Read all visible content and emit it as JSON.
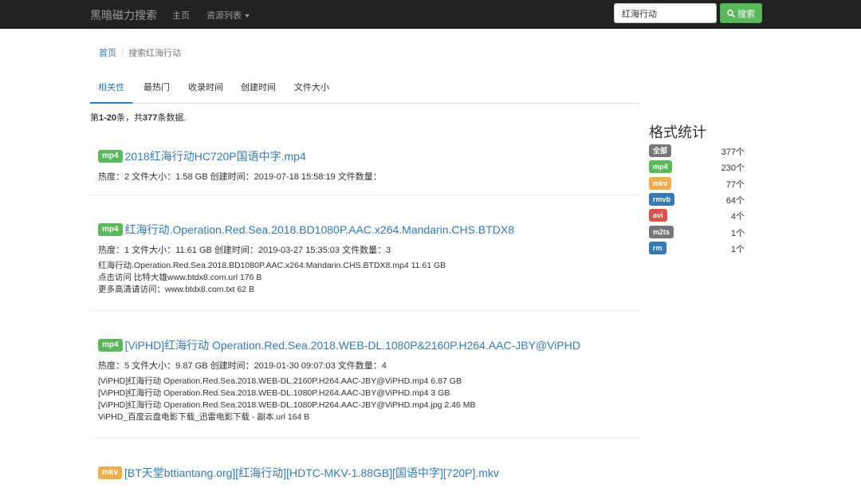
{
  "navbar": {
    "brand": "黑暗磁力搜索",
    "home": "主页",
    "resources": "资源列表",
    "search_value": "红海行动",
    "search_button": "搜索"
  },
  "breadcrumb": {
    "home": "首页",
    "separator": "/",
    "current": "搜索红海行动"
  },
  "tabs": [
    "相关性",
    "最热门",
    "收录时间",
    "创建时间",
    "文件大小"
  ],
  "summary": {
    "prefix": "第",
    "range": "1-20",
    "middle": "条，共",
    "total": "377",
    "suffix": "条数据."
  },
  "results": [
    {
      "format": "mp4",
      "title": "2018红海行动HC720P国语中字.mp4",
      "meta": "热度：2  文件大小：1.58 GB  创建时间：2019-07-18 15:58:19  文件数量：",
      "files": []
    },
    {
      "format": "mp4",
      "title": "红海行动.Operation.Red.Sea.2018.BD1080P.AAC.x264.Mandarin.CHS.BTDX8",
      "meta": "热度：1  文件大小：11.61 GB  创建时间：2019-03-27 15:35:03  文件数量：3",
      "files": [
        "红海行动.Operation.Red.Sea.2018.BD1080P.AAC.x264.Mandarin.CHS.BTDX8.mp4  11.61 GB",
        "点击访问 比特大雄www.btdx8.com.url  176 B",
        "更多高清请访问：www.btdx8.com.txt  62 B"
      ]
    },
    {
      "format": "mp4",
      "title": "[ViPHD]红海行动 Operation.Red.Sea.2018.WEB-DL.1080P&2160P.H264.AAC-JBY@ViPHD",
      "meta": "热度：5  文件大小：9.87 GB  创建时间：2019-01-30 09:07:03  文件数量：4",
      "files": [
        "[ViPHD]红海行动 Operation.Red.Sea.2018.WEB-DL.2160P.H264.AAC-JBY@ViPHD.mp4  6.87 GB",
        "[ViPHD]红海行动 Operation.Red.Sea.2018.WEB-DL.1080P.H264.AAC-JBY@ViPHD.mp4  3 GB",
        "[ViPHD]红海行动 Operation.Red.Sea.2018.WEB-DL.1080P.H264.AAC-JBY@ViPHD.mp4.jpg  2.46 MB",
        "ViPHD_百度云盘电影下载_迅雷电影下载 - 副本.url  164 B"
      ]
    },
    {
      "format": "mkv",
      "title": "[BT天堂bttiantang.org][红海行动][HDTC-MKV-1.88GB][国语中字][720P].mkv",
      "meta": "",
      "files": []
    }
  ],
  "sidebar": {
    "title": "格式统计",
    "stats": [
      {
        "format": "全部",
        "count": "377个",
        "color": "#777777"
      },
      {
        "format": "mp4",
        "count": "230个",
        "color": "#5cb85c"
      },
      {
        "format": "mkv",
        "count": "77个",
        "color": "#f0ad4e"
      },
      {
        "format": "rmvb",
        "count": "64个",
        "color": "#337ab7"
      },
      {
        "format": "avi",
        "count": "4个",
        "color": "#d9534f"
      },
      {
        "format": "m2ts",
        "count": "1个",
        "color": "#777777"
      },
      {
        "format": "rm",
        "count": "1个",
        "color": "#337ab7"
      }
    ]
  }
}
